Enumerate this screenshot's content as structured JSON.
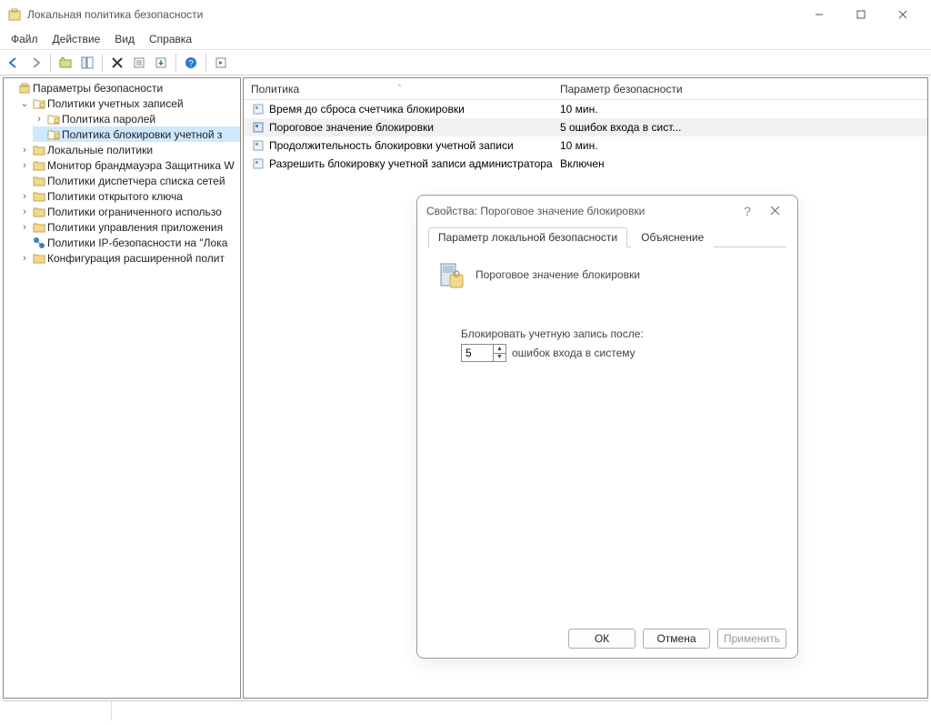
{
  "window": {
    "title": "Локальная политика безопасности"
  },
  "menu": {
    "file": "Файл",
    "action": "Действие",
    "view": "Вид",
    "help": "Справка"
  },
  "tree": {
    "root": "Параметры безопасности",
    "account_policies": "Политики учетных записей",
    "password_policy": "Политика паролей",
    "lockout_policy": "Политика блокировки учетной з",
    "local_policies": "Локальные политики",
    "firewall": "Монитор брандмауэра Защитника W",
    "nlm": "Политики диспетчера списка сетей",
    "public_key": "Политики открытого ключа",
    "software_restrict": "Политики ограниченного использо",
    "app_control": "Политики управления приложения",
    "ipsec": "Политики IP-безопасности на \"Лока",
    "advanced_audit": "Конфигурация расширенной полит"
  },
  "list": {
    "col_policy": "Политика",
    "col_param": "Параметр безопасности",
    "rows": [
      {
        "policy": "Время до сброса счетчика блокировки",
        "param": "10 мин."
      },
      {
        "policy": "Пороговое значение блокировки",
        "param": "5 ошибок входа в сист..."
      },
      {
        "policy": "Продолжительность блокировки учетной записи",
        "param": "10 мин."
      },
      {
        "policy": "Разрешить блокировку учетной записи администратора",
        "param": "Включен"
      }
    ]
  },
  "dialog": {
    "title": "Свойства: Пороговое значение блокировки",
    "tab_local": "Параметр локальной безопасности",
    "tab_explain": "Объяснение",
    "policy_name": "Пороговое значение блокировки",
    "lock_label": "Блокировать учетную запись после:",
    "lock_value": "5",
    "lock_unit": "ошибок входа в систему",
    "ok": "ОК",
    "cancel": "Отмена",
    "apply": "Применить"
  }
}
